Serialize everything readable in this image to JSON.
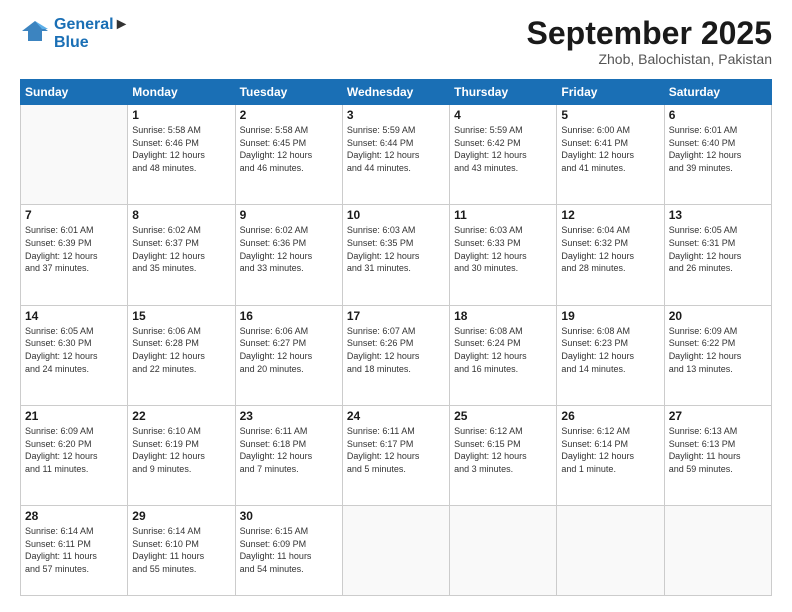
{
  "logo": {
    "line1": "General",
    "line2": "Blue"
  },
  "header": {
    "month": "September 2025",
    "location": "Zhob, Balochistan, Pakistan"
  },
  "weekdays": [
    "Sunday",
    "Monday",
    "Tuesday",
    "Wednesday",
    "Thursday",
    "Friday",
    "Saturday"
  ],
  "weeks": [
    [
      {
        "day": "",
        "info": ""
      },
      {
        "day": "1",
        "info": "Sunrise: 5:58 AM\nSunset: 6:46 PM\nDaylight: 12 hours\nand 48 minutes."
      },
      {
        "day": "2",
        "info": "Sunrise: 5:58 AM\nSunset: 6:45 PM\nDaylight: 12 hours\nand 46 minutes."
      },
      {
        "day": "3",
        "info": "Sunrise: 5:59 AM\nSunset: 6:44 PM\nDaylight: 12 hours\nand 44 minutes."
      },
      {
        "day": "4",
        "info": "Sunrise: 5:59 AM\nSunset: 6:42 PM\nDaylight: 12 hours\nand 43 minutes."
      },
      {
        "day": "5",
        "info": "Sunrise: 6:00 AM\nSunset: 6:41 PM\nDaylight: 12 hours\nand 41 minutes."
      },
      {
        "day": "6",
        "info": "Sunrise: 6:01 AM\nSunset: 6:40 PM\nDaylight: 12 hours\nand 39 minutes."
      }
    ],
    [
      {
        "day": "7",
        "info": "Sunrise: 6:01 AM\nSunset: 6:39 PM\nDaylight: 12 hours\nand 37 minutes."
      },
      {
        "day": "8",
        "info": "Sunrise: 6:02 AM\nSunset: 6:37 PM\nDaylight: 12 hours\nand 35 minutes."
      },
      {
        "day": "9",
        "info": "Sunrise: 6:02 AM\nSunset: 6:36 PM\nDaylight: 12 hours\nand 33 minutes."
      },
      {
        "day": "10",
        "info": "Sunrise: 6:03 AM\nSunset: 6:35 PM\nDaylight: 12 hours\nand 31 minutes."
      },
      {
        "day": "11",
        "info": "Sunrise: 6:03 AM\nSunset: 6:33 PM\nDaylight: 12 hours\nand 30 minutes."
      },
      {
        "day": "12",
        "info": "Sunrise: 6:04 AM\nSunset: 6:32 PM\nDaylight: 12 hours\nand 28 minutes."
      },
      {
        "day": "13",
        "info": "Sunrise: 6:05 AM\nSunset: 6:31 PM\nDaylight: 12 hours\nand 26 minutes."
      }
    ],
    [
      {
        "day": "14",
        "info": "Sunrise: 6:05 AM\nSunset: 6:30 PM\nDaylight: 12 hours\nand 24 minutes."
      },
      {
        "day": "15",
        "info": "Sunrise: 6:06 AM\nSunset: 6:28 PM\nDaylight: 12 hours\nand 22 minutes."
      },
      {
        "day": "16",
        "info": "Sunrise: 6:06 AM\nSunset: 6:27 PM\nDaylight: 12 hours\nand 20 minutes."
      },
      {
        "day": "17",
        "info": "Sunrise: 6:07 AM\nSunset: 6:26 PM\nDaylight: 12 hours\nand 18 minutes."
      },
      {
        "day": "18",
        "info": "Sunrise: 6:08 AM\nSunset: 6:24 PM\nDaylight: 12 hours\nand 16 minutes."
      },
      {
        "day": "19",
        "info": "Sunrise: 6:08 AM\nSunset: 6:23 PM\nDaylight: 12 hours\nand 14 minutes."
      },
      {
        "day": "20",
        "info": "Sunrise: 6:09 AM\nSunset: 6:22 PM\nDaylight: 12 hours\nand 13 minutes."
      }
    ],
    [
      {
        "day": "21",
        "info": "Sunrise: 6:09 AM\nSunset: 6:20 PM\nDaylight: 12 hours\nand 11 minutes."
      },
      {
        "day": "22",
        "info": "Sunrise: 6:10 AM\nSunset: 6:19 PM\nDaylight: 12 hours\nand 9 minutes."
      },
      {
        "day": "23",
        "info": "Sunrise: 6:11 AM\nSunset: 6:18 PM\nDaylight: 12 hours\nand 7 minutes."
      },
      {
        "day": "24",
        "info": "Sunrise: 6:11 AM\nSunset: 6:17 PM\nDaylight: 12 hours\nand 5 minutes."
      },
      {
        "day": "25",
        "info": "Sunrise: 6:12 AM\nSunset: 6:15 PM\nDaylight: 12 hours\nand 3 minutes."
      },
      {
        "day": "26",
        "info": "Sunrise: 6:12 AM\nSunset: 6:14 PM\nDaylight: 12 hours\nand 1 minute."
      },
      {
        "day": "27",
        "info": "Sunrise: 6:13 AM\nSunset: 6:13 PM\nDaylight: 11 hours\nand 59 minutes."
      }
    ],
    [
      {
        "day": "28",
        "info": "Sunrise: 6:14 AM\nSunset: 6:11 PM\nDaylight: 11 hours\nand 57 minutes."
      },
      {
        "day": "29",
        "info": "Sunrise: 6:14 AM\nSunset: 6:10 PM\nDaylight: 11 hours\nand 55 minutes."
      },
      {
        "day": "30",
        "info": "Sunrise: 6:15 AM\nSunset: 6:09 PM\nDaylight: 11 hours\nand 54 minutes."
      },
      {
        "day": "",
        "info": ""
      },
      {
        "day": "",
        "info": ""
      },
      {
        "day": "",
        "info": ""
      },
      {
        "day": "",
        "info": ""
      }
    ]
  ]
}
